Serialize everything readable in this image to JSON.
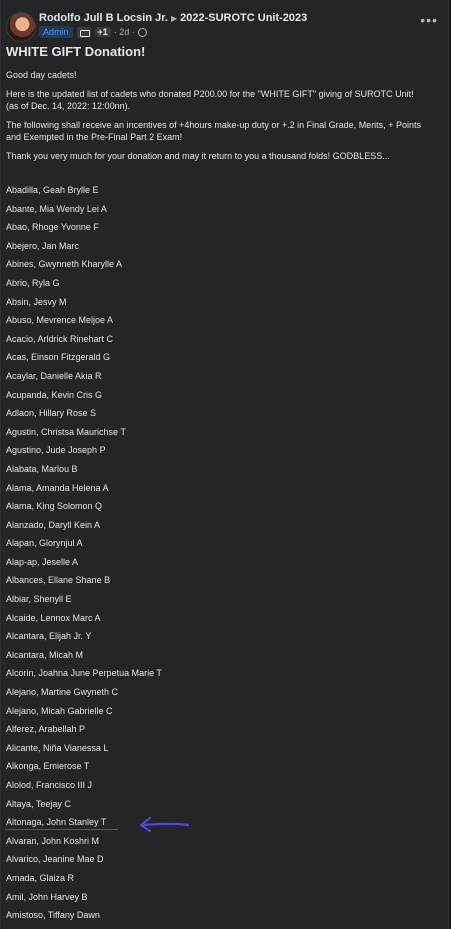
{
  "header": {
    "author": "Rodolfo Jull B Locsin Jr.",
    "group": "2022-SUROTC Unit-2023",
    "badge": "Admin",
    "plus_badge": "+1",
    "time": "· 2d ·",
    "more_icon": "more-horizontal-icon"
  },
  "post": {
    "title": "WHITE GIFT Donation!",
    "paragraphs": [
      "Good day cadets!",
      "Here is the updated list of cadets who donated P200.00 for the \"WHITE GIFT\" giving of SUROTC Unit!",
      "(as of Dec. 14, 2022: 12:00nn).",
      "The following shall receive an incentives of +4hours make-up duty or +.2 in Final Grade, Merits, + Points and Exempted in the Pre-Final Part 2 Exam!",
      "Thank you very much for your donation and may it return to you a thousand folds! GODBLESS..."
    ],
    "names": [
      "Abadilla, Geah Brylle E",
      "Abante, Mia Wendy Lei A",
      "Abao, Rhoge Yvonne F",
      "Abejero, Jan Marc",
      "Abines, Gwynneth Kharylle A",
      "Abrio, Ryla G",
      "Absin, Jesvy M",
      "Abuso, Mevrence Meljoe A",
      "Acacio, Arldrick Rinehart C",
      "Acas, Einson Fitzgerald G",
      "Acaylar, Danielle Akia R",
      "Acupanda, Kevin Cris G",
      "Adlaon, Hillary Rose S",
      "Agustin, Christsa Maurichse T",
      "Agustino, Jude Joseph P",
      "Alabata, Marlou B",
      "Alama, Amanda Helena A",
      "Alama, King Solomon Q",
      "Alanzado, Daryll Kein A",
      "Alapan, Glorynjul A",
      "Alap-ap, Jeselle A",
      "Albances, Ellane Shane B",
      "Albiar, Shenyll E",
      "Alcaide, Lennox Marc A",
      "Alcantara, Elijah Jr. Y",
      "Alcantara, Micah M",
      "Alcorin, Joahna June Perpetua Marie T",
      "Alejano, Martine Gwyneth C",
      "Alejano, Micah Gabrielle C",
      "Alferez, Arabellah P",
      "Alicante, Niña Vianessa L",
      "Alkonga, Emierose T",
      "Alolod, Francisco III J",
      "Altaya, Teejay C",
      "Altonaga, John Stanley T",
      "Alvaran, John Koshri M",
      "Alvarico, Jeanine Mae D",
      "Amada, Glaiza R",
      "Amil, John Harvey B",
      "Amistoso, Tiffany Dawn"
    ]
  },
  "colors": {
    "background": "#18191a",
    "card": "#242526",
    "annotation": "#4c49d6",
    "admin_badge": "#4599ff"
  }
}
